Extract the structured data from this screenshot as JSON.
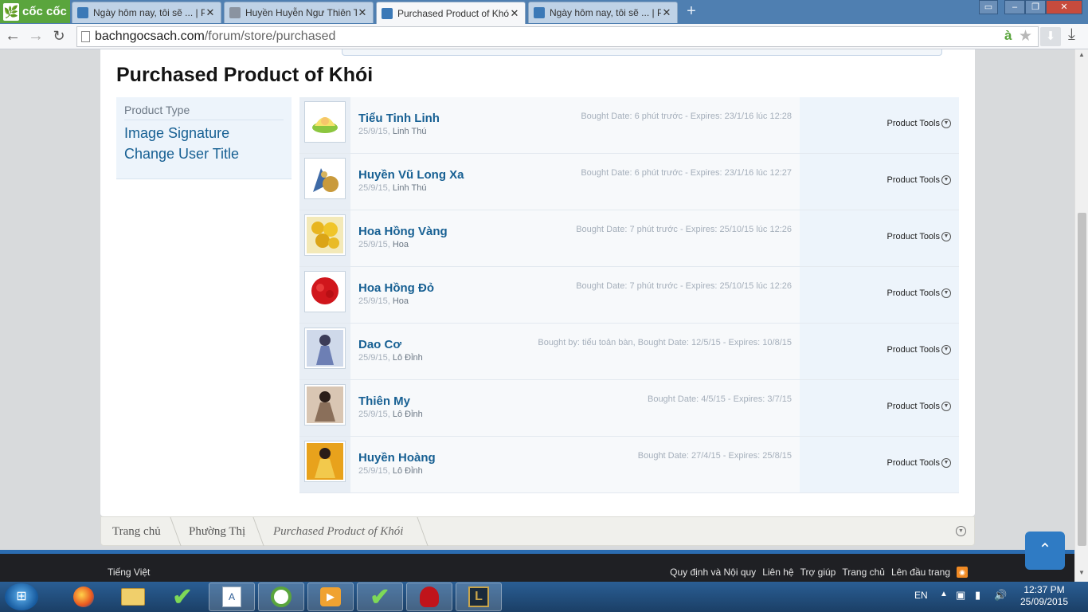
{
  "browser": {
    "brand": "cốc cốc",
    "tabs": [
      {
        "title": "Ngày hôm nay, tôi sẽ ... | P",
        "active": false
      },
      {
        "title": "Huyền Huyễn Ngư Thiên T",
        "active": false
      },
      {
        "title": "Purchased Product of Khói",
        "active": true
      },
      {
        "title": "Ngày hôm nay, tôi sẽ ... | P",
        "active": false
      }
    ],
    "url_domain": "bachngocsach.com",
    "url_path": "/forum/store/purchased",
    "url_badge": "à"
  },
  "page": {
    "title": "Purchased Product of Khói",
    "sidebar": {
      "heading": "Product Type",
      "links": [
        "Image Signature",
        "Change User Title"
      ]
    },
    "products": [
      {
        "name": "Tiểu Tinh Linh",
        "date": "25/9/15",
        "category": "Linh Thú",
        "info": "Bought Date: 6 phút trước - Expires: 23/1/16 lúc 12:28",
        "tools": "Product Tools"
      },
      {
        "name": "Huyền Vũ Long Xa",
        "date": "25/9/15",
        "category": "Linh Thú",
        "info": "Bought Date: 6 phút trước - Expires: 23/1/16 lúc 12:27",
        "tools": "Product Tools"
      },
      {
        "name": "Hoa Hồng Vàng",
        "date": "25/9/15",
        "category": "Hoa",
        "info": "Bought Date: 7 phút trước - Expires: 25/10/15 lúc 12:26",
        "tools": "Product Tools"
      },
      {
        "name": "Hoa Hồng Đỏ",
        "date": "25/9/15",
        "category": "Hoa",
        "info": "Bought Date: 7 phút trước - Expires: 25/10/15 lúc 12:26",
        "tools": "Product Tools"
      },
      {
        "name": "Dao Cơ",
        "date": "25/9/15",
        "category": "Lô Đỉnh",
        "info": "Bought by: tiểu toản bàn, Bought Date: 12/5/15 - Expires: 10/8/15",
        "tools": "Product Tools"
      },
      {
        "name": "Thiên My",
        "date": "25/9/15",
        "category": "Lô Đỉnh",
        "info": "Bought Date: 4/5/15 - Expires: 3/7/15",
        "tools": "Product Tools"
      },
      {
        "name": "Huyền Hoàng",
        "date": "25/9/15",
        "category": "Lô Đỉnh",
        "info": "Bought Date: 27/4/15 - Expires: 25/8/15",
        "tools": "Product Tools"
      }
    ],
    "breadcrumb": [
      "Trang chủ",
      "Phường Thị",
      "Purchased Product of Khói"
    ]
  },
  "footer": {
    "language": "Tiếng Việt",
    "links": [
      "Quy định và Nội quy",
      "Liên hệ",
      "Trợ giúp",
      "Trang chủ",
      "Lên đầu trang"
    ]
  },
  "taskbar": {
    "lang": "EN",
    "time": "12:37 PM",
    "date": "25/09/2015"
  },
  "colors": {
    "link": "#176093",
    "muted": "#a5afbb",
    "footer_bg": "#1f2024",
    "accent": "#2f7bc4"
  }
}
